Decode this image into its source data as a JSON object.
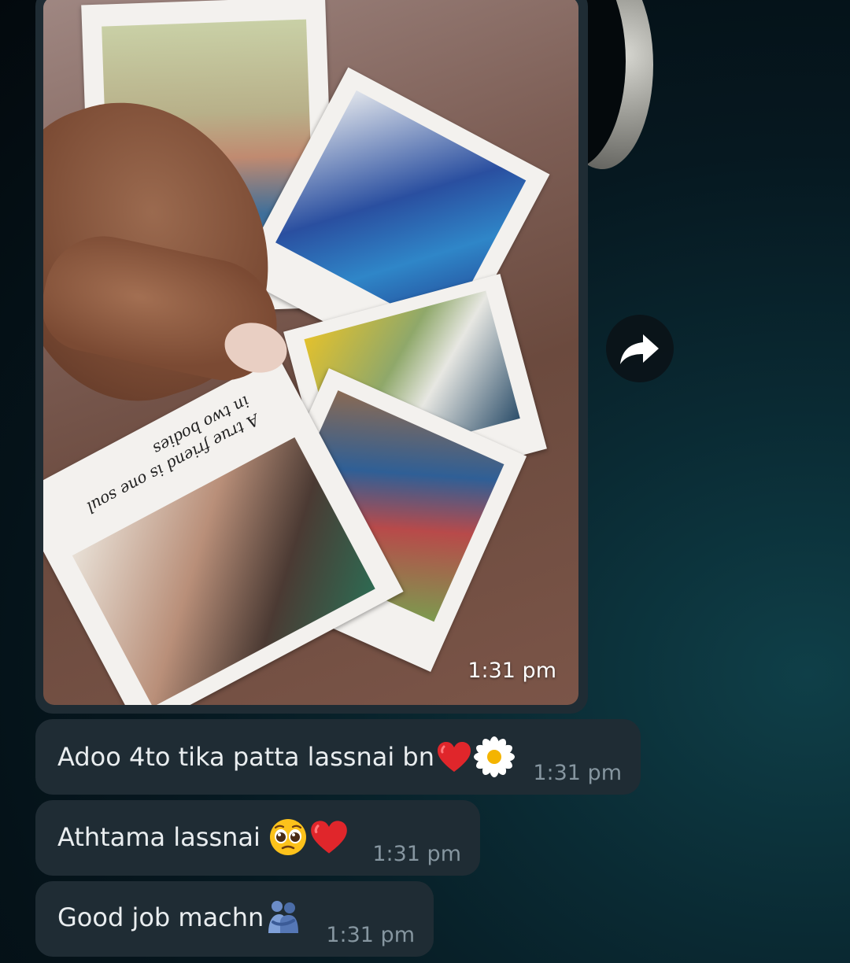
{
  "image_message": {
    "time": "1:31 pm",
    "photo_captions": [
      "A true friend is one soul in two bodies"
    ]
  },
  "messages": [
    {
      "text": "Adoo 4to tika patta lassnai bn",
      "emojis": [
        "red-heart",
        "daisy"
      ],
      "time": "1:31 pm"
    },
    {
      "text": "Athtama lassnai",
      "emojis": [
        "pleading-face",
        "red-heart"
      ],
      "time": "1:31 pm"
    },
    {
      "text": "Good job machn",
      "emojis": [
        "people-hugging"
      ],
      "time": "1:31 pm"
    }
  ],
  "colors": {
    "bubble": "#1f2c34",
    "text": "#e9edef",
    "timestamp": "#8696a0"
  }
}
